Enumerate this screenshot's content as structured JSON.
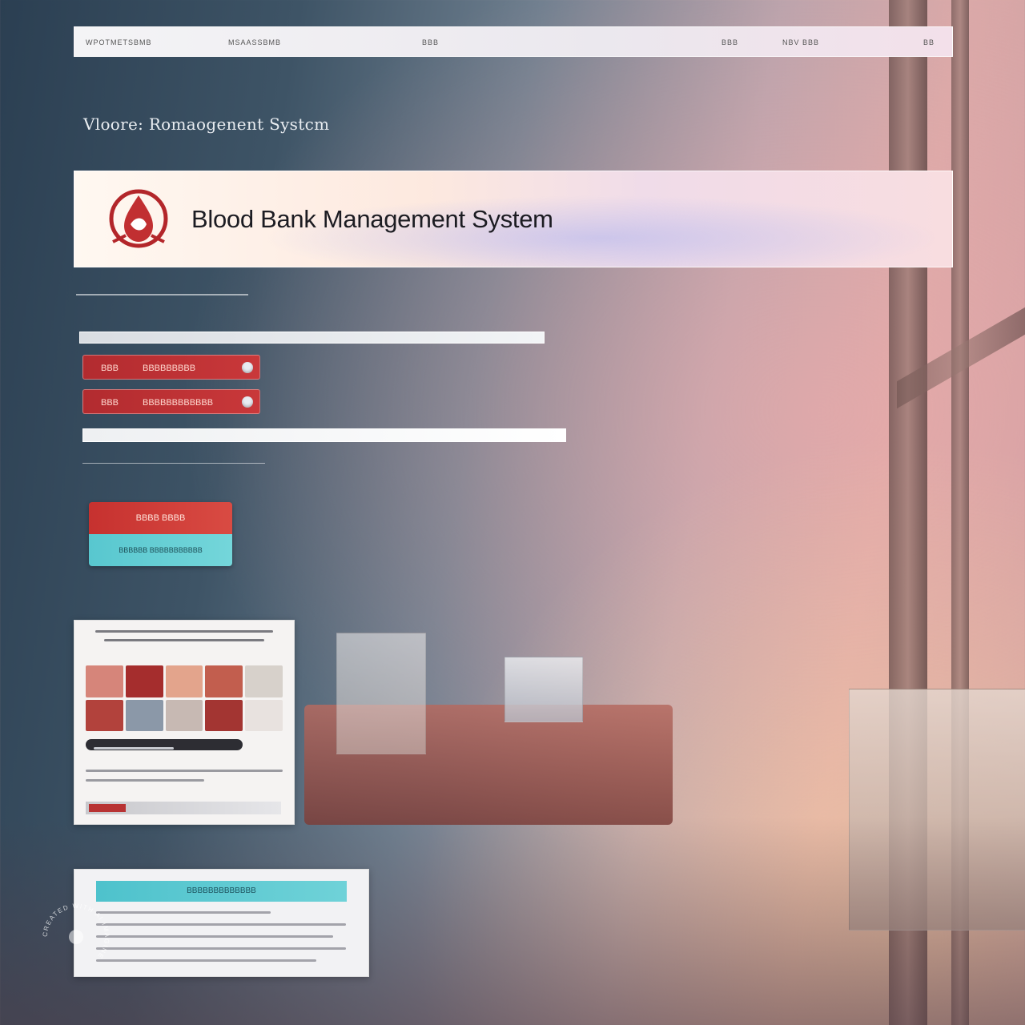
{
  "nav": {
    "items": [
      "WPOTMETSBMB",
      "MSAASSBMB",
      "BBB",
      "BBB",
      "NBV BBB",
      "BB"
    ]
  },
  "subtitle": "Vloore: Romaogenent Systcm",
  "hero": {
    "title": "Blood Bank Management System"
  },
  "pills": [
    {
      "code": "BBB",
      "name": "BBBBBBBBB"
    },
    {
      "code": "BBB",
      "name": "BBBBBBBBBBBB"
    }
  ],
  "cta": {
    "primary_label": "BBBB BBBB",
    "secondary_label": "BBBBBB BBBBBBBBBBB"
  },
  "card2": {
    "header_label": "BBBBBBBBBBBBB"
  },
  "watermark": "CREATED WITH AI IMAGINE",
  "colors": {
    "brand_red": "#c9383a",
    "accent_teal": "#58c7cf",
    "hero_title": "#1c1c22"
  }
}
